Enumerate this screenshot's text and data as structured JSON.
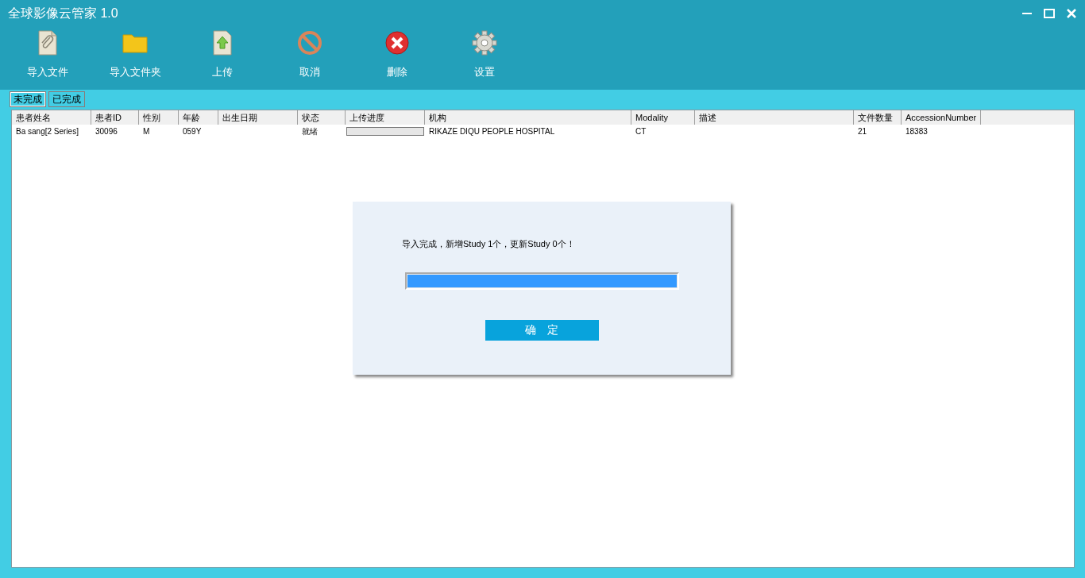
{
  "window": {
    "title": "全球影像云管家 1.0"
  },
  "toolbar": [
    {
      "kind": "file",
      "label": "导入文件"
    },
    {
      "kind": "folder",
      "label": "导入文件夹"
    },
    {
      "kind": "upload",
      "label": "上传"
    },
    {
      "kind": "cancel",
      "label": "取消"
    },
    {
      "kind": "delete",
      "label": "删除"
    },
    {
      "kind": "settings",
      "label": "设置"
    }
  ],
  "tabs": [
    {
      "label": "未完成",
      "selected": true
    },
    {
      "label": "已完成",
      "selected": false
    }
  ],
  "table": {
    "columns": [
      "患者姓名",
      "患者ID",
      "性别",
      "年龄",
      "出生日期",
      "状态",
      "上传进度",
      "机构",
      "Modality",
      "描述",
      "文件数量",
      "AccessionNumber"
    ],
    "rows": [
      {
        "cells": [
          {
            "kind": "text",
            "text": "Ba sang[2 Series]"
          },
          {
            "kind": "text",
            "text": "30096"
          },
          {
            "kind": "text",
            "text": "M"
          },
          {
            "kind": "text",
            "text": "059Y"
          },
          {
            "kind": "blank"
          },
          {
            "kind": "text",
            "text": "就绪"
          },
          {
            "kind": "progress",
            "level": 0
          },
          {
            "kind": "text",
            "text": "RIKAZE DIQU PEOPLE HOSPITAL"
          },
          {
            "kind": "text",
            "text": "CT"
          },
          {
            "kind": "blank"
          },
          {
            "kind": "text",
            "text": "21"
          },
          {
            "kind": "text",
            "text": "18383"
          }
        ]
      }
    ]
  },
  "dialog": {
    "message": "导入完成，新增Study 1个，更新Study 0个！",
    "progress": {
      "level": 1
    },
    "button": "确　定"
  }
}
